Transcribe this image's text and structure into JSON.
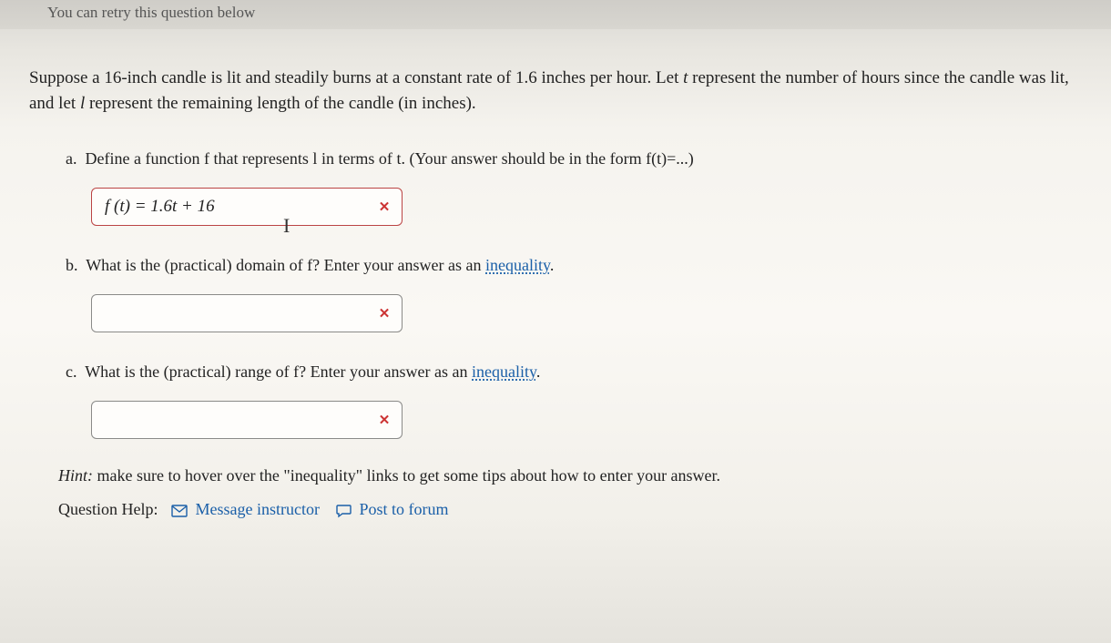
{
  "retry_text": "You can retry this question below",
  "problem": {
    "line1_a": "Suppose a 16-inch candle is lit and steadily burns at a constant rate of 1.6 inches per hour. Let ",
    "var_t": "t",
    "line1_b": " represent the number of hours since the candle was lit, and let ",
    "var_l": "l",
    "line1_c": " represent the remaining length of the candle (in inches)."
  },
  "parts": {
    "a": {
      "label": "a.",
      "prompt_a": "Define a function ",
      "f": "f",
      "prompt_b": " that represents ",
      "l": "l",
      "prompt_c": " in terms of ",
      "t": "t",
      "prompt_d": ". (Your answer should be in the form f(t)=...)",
      "answer_text": "f (t) = 1.6t + 16"
    },
    "b": {
      "label": "b.",
      "prompt_a": "What is the (practical) domain of ",
      "f": "f",
      "prompt_b": "? Enter your answer as an ",
      "link": "inequality",
      "prompt_c": "."
    },
    "c": {
      "label": "c.",
      "prompt_a": "What is the (practical) range of ",
      "f": "f",
      "prompt_b": "? Enter your answer as an ",
      "link": "inequality",
      "prompt_c": "."
    }
  },
  "hint": {
    "label": "Hint:",
    "text": " make sure to hover over the \"inequality\" links to get some tips about how to enter your answer."
  },
  "help": {
    "label": "Question Help:",
    "msg": "Message instructor",
    "post": "Post to forum"
  },
  "icons": {
    "incorrect": "✕"
  }
}
